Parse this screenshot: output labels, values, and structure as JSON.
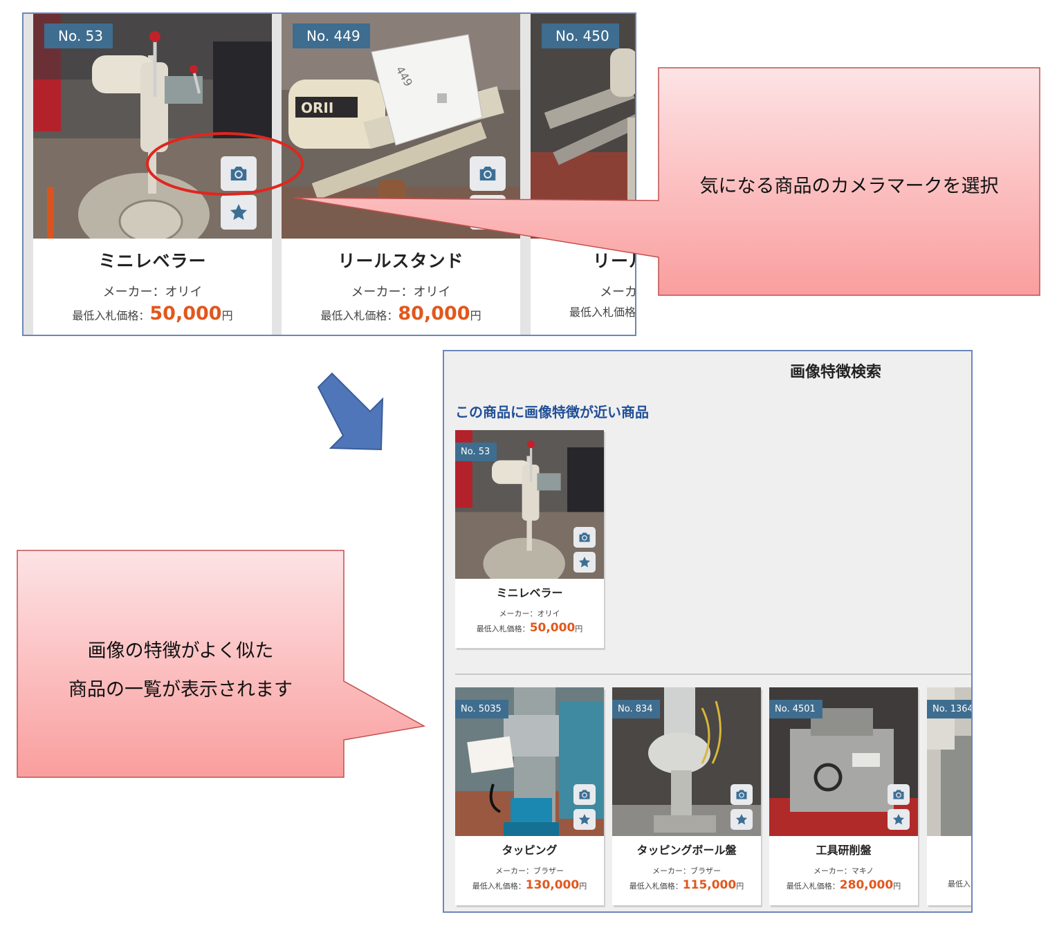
{
  "top_strip": {
    "cards": [
      {
        "badge": "No. 53",
        "name": "ミニレベラー",
        "maker": "メーカー：オリイ",
        "price_label": "最低入札価格：",
        "price": "50,000",
        "yen": "円"
      },
      {
        "badge": "No. 449",
        "name": "リールスタンド",
        "maker": "メーカー：オリイ",
        "price_label": "最低入札価格：",
        "price": "80,000",
        "yen": "円"
      },
      {
        "badge": "No. 450",
        "name": "リール",
        "maker": "メーカ",
        "price_label": "最低入札価格",
        "price": "",
        "yen": ""
      }
    ]
  },
  "callout_top": {
    "text": "気になる商品のカメラマークを選択"
  },
  "callout_bottom": {
    "line1": "画像の特徴がよく似た",
    "line2": "商品の一覧が表示されます"
  },
  "panel": {
    "title": "画像特徴検索",
    "subtitle": "この商品に画像特徴が近い商品",
    "reference": {
      "badge": "No. 53",
      "name": "ミニレベラー",
      "maker": "メーカー：オリイ",
      "price_label": "最低入札価格：",
      "price": "50,000",
      "yen": "円"
    },
    "results": [
      {
        "badge": "No. 5035",
        "name": "タッピング",
        "maker": "メーカー：ブラザー",
        "price_label": "最低入札価格：",
        "price": "130,000",
        "yen": "円"
      },
      {
        "badge": "No. 834",
        "name": "タッピングボール盤",
        "maker": "メーカー：ブラザー",
        "price_label": "最低入札価格：",
        "price": "115,000",
        "yen": "円"
      },
      {
        "badge": "No. 4501",
        "name": "工具研削盤",
        "maker": "メーカー：マキノ",
        "price_label": "最低入札価格：",
        "price": "280,000",
        "yen": "円"
      },
      {
        "badge": "No. 1364",
        "name": "",
        "maker": "",
        "price_label": "最低入",
        "price": "",
        "yen": ""
      }
    ]
  },
  "icons": {
    "camera": "camera-icon",
    "star": "star-icon",
    "arrow": "arrow-down-right-icon"
  },
  "colors": {
    "badge": "#3f6d8f",
    "price": "#e2571c",
    "subtitle": "#1f4e96",
    "callout_top": "#fde3e5",
    "callout_bottom": "#fa9e9e",
    "arrow": "#4f76b8",
    "highlight": "#e0261f"
  }
}
